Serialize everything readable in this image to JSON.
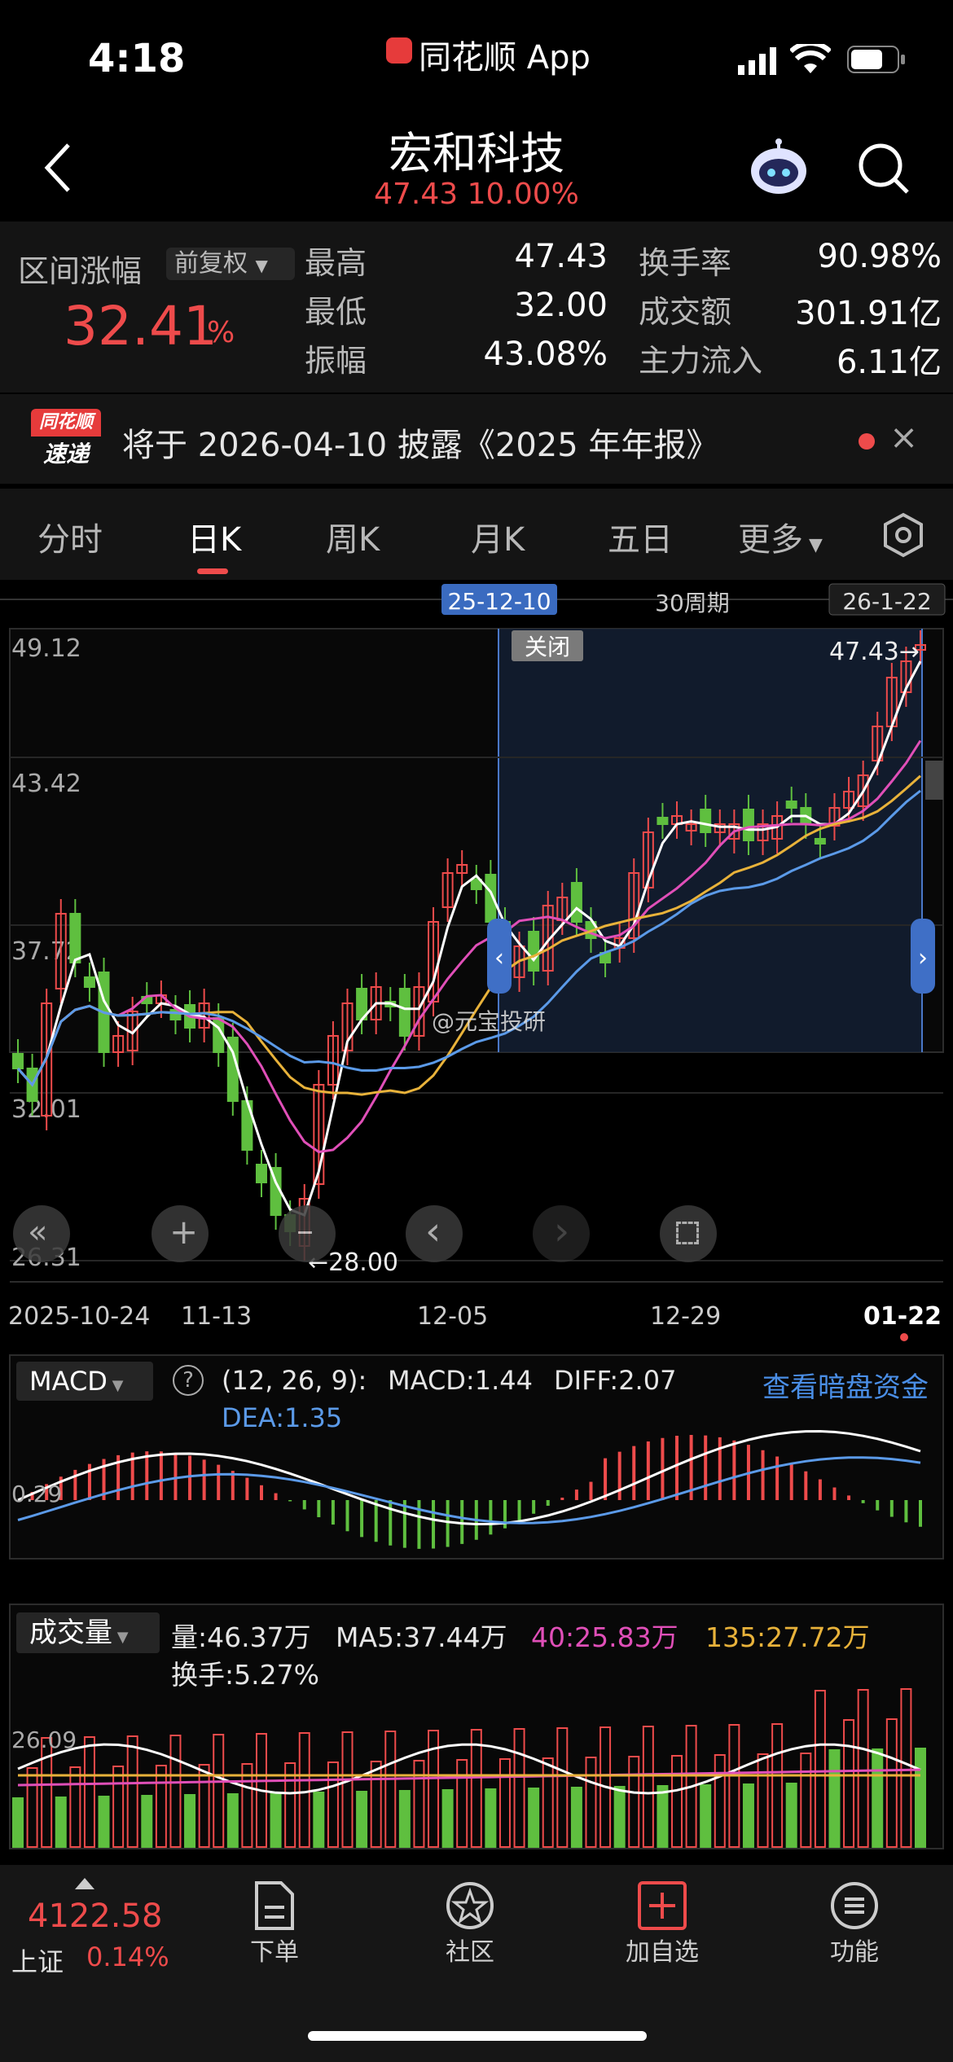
{
  "status_bar": {
    "time": "4:18",
    "app_name": "同花顺 App"
  },
  "header": {
    "title": "宏和科技",
    "price": "47.43",
    "change_pct": "10.00%"
  },
  "stats": {
    "range_label": "区间涨幅",
    "adjust_label": "前复权",
    "range_value": "32.41",
    "range_unit": "%",
    "items": [
      {
        "label": "最高",
        "value": "47.43"
      },
      {
        "label": "最低",
        "value": "32.00"
      },
      {
        "label": "振幅",
        "value": "43.08%"
      },
      {
        "label": "换手率",
        "value": "90.98%"
      },
      {
        "label": "成交额",
        "value": "301.91亿"
      },
      {
        "label": "主力流入",
        "value": "6.11亿"
      }
    ]
  },
  "notice": {
    "badge_top": "同花顺",
    "badge_bottom": "速递",
    "text": "将于 2026-04-10 披露《2025 年年报》"
  },
  "tabs": [
    {
      "label": "分时"
    },
    {
      "label": "日K",
      "active": true
    },
    {
      "label": "周K"
    },
    {
      "label": "月K"
    },
    {
      "label": "五日"
    },
    {
      "label": "更多"
    }
  ],
  "kline": {
    "range_start": "25-12-10",
    "period": "30周期",
    "range_end": "26-1-22",
    "close_label": "关闭",
    "y_labels": [
      "49.12",
      "43.42",
      "37.72",
      "32.01",
      "26.31"
    ],
    "high_marker": "47.43→",
    "low_marker": "←28.00",
    "x_labels": [
      "2025-10-24",
      "11-13",
      "12-05",
      "12-29",
      "01-22"
    ],
    "watermark": "@元宝投研"
  },
  "macd": {
    "name": "MACD",
    "params": "(12, 26, 9):",
    "macd": "MACD:1.44",
    "diff": "DIFF:2.07",
    "dea": "DEA:1.35",
    "link": "查看暗盘资金",
    "y_label": "0.29"
  },
  "volume": {
    "name": "成交量",
    "vol": "量:46.37万",
    "ma5": "MA5:37.44万",
    "ma40": "40:25.83万",
    "ma135": "135:27.72万",
    "turnover": "换手:5.27%",
    "y_label": "26.09"
  },
  "bottom_nav": {
    "index_value": "4122.58",
    "index_name": "上证",
    "index_pct": "0.14%",
    "items": [
      {
        "label": "下单"
      },
      {
        "label": "社区"
      },
      {
        "label": "加自选"
      },
      {
        "label": "功能"
      }
    ]
  },
  "colors": {
    "up": "#ee4b4b",
    "down": "#5fbf3f",
    "accent_blue": "#4a78c8"
  }
}
